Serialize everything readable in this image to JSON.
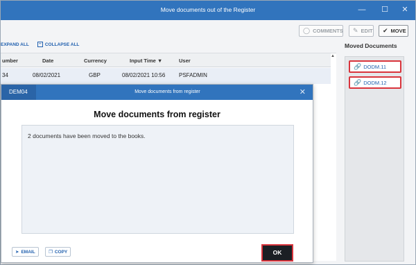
{
  "window": {
    "title": "Move documents out of the Register",
    "controls": {
      "minimize": "—",
      "maximize": "☐",
      "close": "✕"
    }
  },
  "toolbar": {
    "comments_label": "COMMENTS",
    "edit_label": "EDIT",
    "move_label": "MOVE"
  },
  "grid_controls": {
    "expand_all": "EXPAND ALL",
    "collapse_all": "COLLAPSE ALL"
  },
  "grid": {
    "columns": [
      "umber",
      "Date",
      "Currency",
      "Input Time",
      "User"
    ],
    "sort_indicator": "▼",
    "rows": [
      {
        "number": "34",
        "date": "08/02/2021",
        "currency": "GBP",
        "input_time": "08/02/2021 10:56",
        "user": "PSFADMIN"
      }
    ]
  },
  "moved_documents": {
    "label": "Moved Documents",
    "items": [
      "DODM.11",
      "DODM.12"
    ]
  },
  "modal": {
    "tag": "DEM04",
    "title": "Move documents from register",
    "heading": "Move documents from register",
    "message": "2 documents have been moved to the books.",
    "email_label": "EMAIL",
    "copy_label": "COPY",
    "ok_label": "OK"
  },
  "icons": {
    "comment": "comment-icon",
    "edit": "edit-icon",
    "move": "check-circle-icon",
    "link": "link-icon",
    "email": "send-icon",
    "copy": "copy-icon"
  },
  "colors": {
    "titlebar": "#3174bd",
    "highlight": "#d9343c",
    "link": "#1f5fae"
  }
}
